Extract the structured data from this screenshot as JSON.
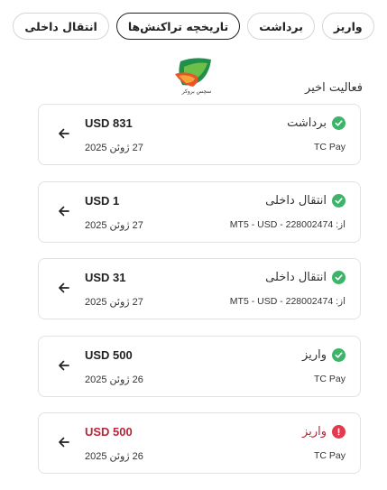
{
  "tabs": [
    {
      "label": "واریز",
      "active": false
    },
    {
      "label": "برداشت",
      "active": false
    },
    {
      "label": "تاریخچه تراکنش‌ها",
      "active": true
    },
    {
      "label": "انتقال داخلی",
      "active": false
    }
  ],
  "logo": {
    "caption": "سچس بروکر"
  },
  "section_title": "فعالیت اخیر",
  "transactions": [
    {
      "type": "برداشت",
      "status": "success",
      "source": "TC Pay",
      "amount": "USD 831",
      "date": "27 ژوئن 2025"
    },
    {
      "type": "انتقال داخلی",
      "status": "success",
      "source": "از: MT5 - USD - 228002474",
      "amount": "USD 1",
      "date": "27 ژوئن 2025"
    },
    {
      "type": "انتقال داخلی",
      "status": "success",
      "source": "از: MT5 - USD - 228002474",
      "amount": "USD 31",
      "date": "27 ژوئن 2025"
    },
    {
      "type": "واریز",
      "status": "success",
      "source": "TC Pay",
      "amount": "USD 500",
      "date": "26 ژوئن 2025"
    },
    {
      "type": "واریز",
      "status": "failed",
      "source": "TC Pay",
      "amount": "USD 500",
      "date": "26 ژوئن 2025"
    }
  ],
  "colors": {
    "success": "#3cb56a",
    "failed": "#e53950",
    "failed_text": "#b8263a"
  },
  "icons": {
    "success": "check-circle-icon",
    "failed": "exclamation-circle-icon",
    "arrow": "arrow-left-icon"
  }
}
